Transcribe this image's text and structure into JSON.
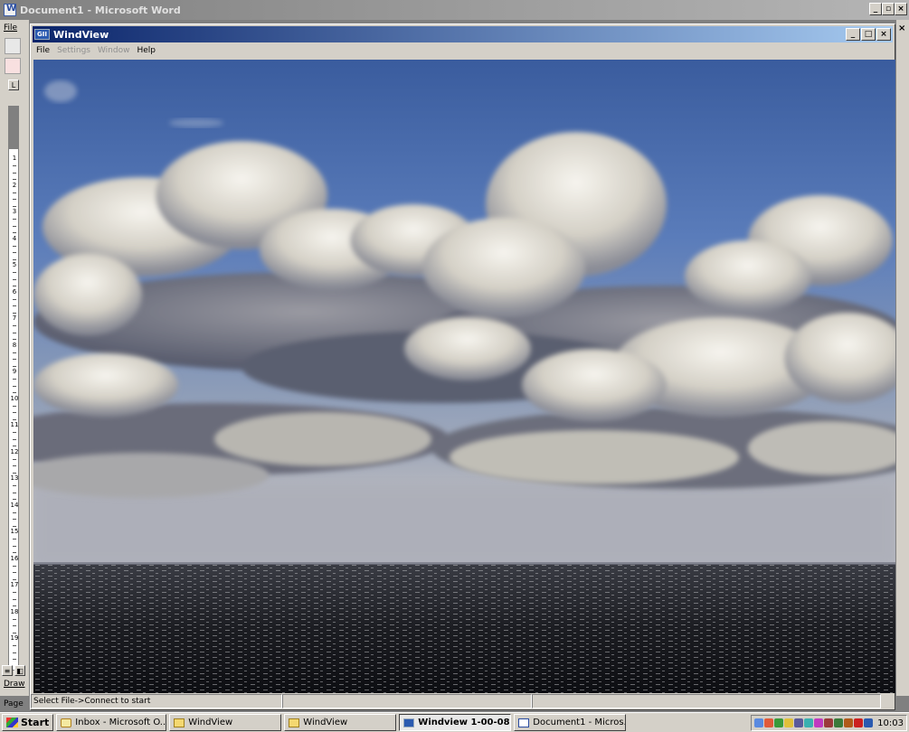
{
  "word": {
    "title": "Document1 - Microsoft Word",
    "menu_file": "File",
    "draw_label": "Draw",
    "page_label": "Page",
    "ruler_marks": [
      "1",
      "2",
      "3",
      "4",
      "5",
      "6",
      "7",
      "8",
      "9",
      "10",
      "11",
      "12",
      "13",
      "14",
      "15",
      "16",
      "17",
      "18",
      "19"
    ]
  },
  "windview": {
    "title": "WindView",
    "icon_text": "GII",
    "menu": {
      "file": "File",
      "settings": "Settings",
      "window": "Window",
      "help": "Help"
    },
    "status": "Select File->Connect to start"
  },
  "taskbar": {
    "start": "Start",
    "buttons": [
      {
        "label": "Inbox - Microsoft O...",
        "icon": "inbox-icon",
        "active": false
      },
      {
        "label": "WindView",
        "icon": "folder-icon",
        "active": false
      },
      {
        "label": "WindView",
        "icon": "folder-icon",
        "active": false
      },
      {
        "label": "Windview 1-00-08",
        "icon": "gii-icon",
        "active": true
      },
      {
        "label": "Document1 - Micros...",
        "icon": "word-icon",
        "active": false
      }
    ],
    "tray_icons": [
      "#5a8ae0",
      "#e05a3a",
      "#3a9a3a",
      "#e0c03a",
      "#5a5a9a",
      "#3ab0b0",
      "#c03ac0",
      "#9a3a3a",
      "#3a7a3a",
      "#b05a1a",
      "#cc2020",
      "#2a5ab0"
    ],
    "clock": "10:03"
  },
  "colors": {
    "titlebar_active_start": "#0a246a",
    "titlebar_active_end": "#a6caf0",
    "face": "#d4d0c8"
  }
}
